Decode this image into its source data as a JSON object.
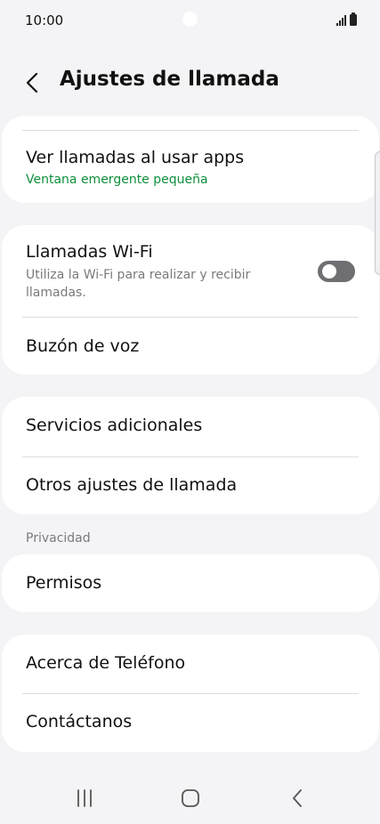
{
  "status_bar": {
    "time": "10:00",
    "icons": [
      "signal-icon",
      "battery-icon"
    ]
  },
  "header": {
    "back_icon": "chevron-left-icon",
    "title": "Ajustes de llamada"
  },
  "cards": {
    "popup": {
      "title": "Ver llamadas al usar apps",
      "subtitle": "Ventana emergente pequeña",
      "subtitle_color": "#0f8f3c"
    },
    "wifi_calls": {
      "title": "Llamadas Wi-Fi",
      "subtitle": "Utiliza la Wi-Fi para realizar y recibir llamadas.",
      "toggle_on": false
    },
    "voicemail": {
      "title": "Buzón de voz"
    },
    "additional_services": {
      "title": "Servicios adicionales"
    },
    "other_settings": {
      "title": "Otros ajustes de llamada"
    }
  },
  "privacy": {
    "section_label": "Privacidad",
    "permissions": "Permisos"
  },
  "about": {
    "about_phone": "Acerca de Teléfono",
    "contact_us": "Contáctanos"
  },
  "nav_bar": {
    "recents_icon": "recents-icon",
    "home_icon": "home-icon",
    "back_icon": "back-icon"
  }
}
